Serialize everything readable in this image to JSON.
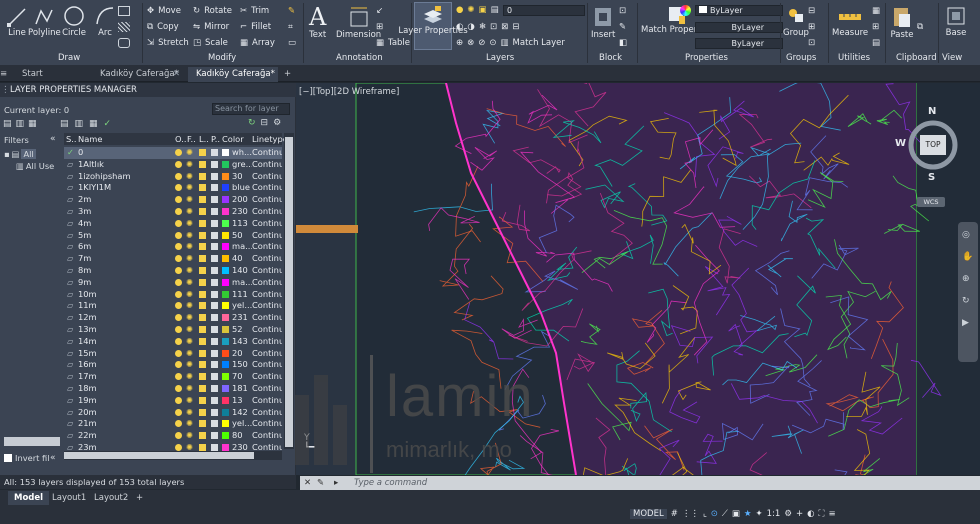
{
  "ribbon": {
    "draw": {
      "line": "Line",
      "polyline": "Polyline",
      "circle": "Circle",
      "arc": "Arc",
      "panel": "Draw"
    },
    "modify": {
      "move": "Move",
      "rotate": "Rotate",
      "trim": "Trim",
      "copy": "Copy",
      "mirror": "Mirror",
      "fillet": "Fillet",
      "stretch": "Stretch",
      "scale": "Scale",
      "array": "Array",
      "panel": "Modify"
    },
    "annotation": {
      "text": "Text",
      "dimension": "Dimension",
      "table": "Table",
      "panel": "Annotation"
    },
    "layers": {
      "layer_properties": "Layer Properties",
      "current_layer_value": "0",
      "match_layer": "Match Layer",
      "panel": "Layers"
    },
    "block": {
      "insert": "Insert",
      "panel": "Block"
    },
    "properties": {
      "match_properties": "Match Properties",
      "bylayer_color": "ByLayer",
      "bylayer_linetype": "ByLayer",
      "bylayer_lineweight": "ByLayer",
      "panel": "Properties"
    },
    "groups": {
      "group": "Group",
      "panel": "Groups"
    },
    "utilities": {
      "measure": "Measure",
      "panel": "Utilities"
    },
    "clipboard": {
      "paste": "Paste",
      "panel": "Clipboard"
    },
    "view": {
      "base": "Base",
      "panel": "View"
    }
  },
  "doc_tabs": {
    "start": "Start",
    "tab1": "Kadıköy Caferağa*",
    "tab2": "Kadıköy Caferağa*"
  },
  "layer_manager": {
    "title": "LAYER PROPERTIES MANAGER",
    "current_layer": "Current layer: 0",
    "search_placeholder": "Search for layer",
    "filters_label": "Filters",
    "tree_all": "All",
    "tree_used": "All Use",
    "invert_filter": "Invert fil",
    "columns": {
      "status": "S..",
      "name": "Name",
      "on": "O..",
      "freeze": "F..",
      "lock": "L..",
      "plot": "P..",
      "color": "Color",
      "linetype": "Linetype"
    },
    "layers": [
      {
        "name": "0",
        "color": "wh...",
        "hex": "#ffffff",
        "linetype": "Continu..."
      },
      {
        "name": "1Altlık",
        "color": "gre...",
        "hex": "#22c55e",
        "linetype": "Continu..."
      },
      {
        "name": "1izohipsham",
        "color": "30",
        "hex": "#ff8c1a",
        "linetype": "Continu..."
      },
      {
        "name": "1KIYI1M",
        "color": "blue",
        "hex": "#2040ff",
        "linetype": "Continu..."
      },
      {
        "name": "2m",
        "color": "200",
        "hex": "#9933ff",
        "linetype": "Continu..."
      },
      {
        "name": "3m",
        "color": "230",
        "hex": "#ff33cc",
        "linetype": "Continu..."
      },
      {
        "name": "4m",
        "color": "113",
        "hex": "#4dff4d",
        "linetype": "Continu..."
      },
      {
        "name": "5m",
        "color": "50",
        "hex": "#ffe600",
        "linetype": "Continu..."
      },
      {
        "name": "6m",
        "color": "ma...",
        "hex": "#ff00ff",
        "linetype": "Continu..."
      },
      {
        "name": "7m",
        "color": "40",
        "hex": "#ffbf00",
        "linetype": "Continu..."
      },
      {
        "name": "8m",
        "color": "140",
        "hex": "#00bfff",
        "linetype": "Continu..."
      },
      {
        "name": "9m",
        "color": "ma...",
        "hex": "#ff00ff",
        "linetype": "Continu..."
      },
      {
        "name": "10m",
        "color": "111",
        "hex": "#33cc33",
        "linetype": "Continu..."
      },
      {
        "name": "11m",
        "color": "yel...",
        "hex": "#ffff00",
        "linetype": "Continu..."
      },
      {
        "name": "12m",
        "color": "231",
        "hex": "#ff6699",
        "linetype": "Continu..."
      },
      {
        "name": "13m",
        "color": "52",
        "hex": "#d9c43a",
        "linetype": "Continu..."
      },
      {
        "name": "14m",
        "color": "143",
        "hex": "#1a9fbf",
        "linetype": "Continu..."
      },
      {
        "name": "15m",
        "color": "20",
        "hex": "#ff4d1a",
        "linetype": "Continu..."
      },
      {
        "name": "16m",
        "color": "150",
        "hex": "#0080ff",
        "linetype": "Continu..."
      },
      {
        "name": "17m",
        "color": "70",
        "hex": "#80ff00",
        "linetype": "Continu..."
      },
      {
        "name": "18m",
        "color": "181",
        "hex": "#7f66ff",
        "linetype": "Continu..."
      },
      {
        "name": "19m",
        "color": "13",
        "hex": "#ff3366",
        "linetype": "Continu..."
      },
      {
        "name": "20m",
        "color": "142",
        "hex": "#0f7f99",
        "linetype": "Continu..."
      },
      {
        "name": "21m",
        "color": "yel...",
        "hex": "#ffff00",
        "linetype": "Continu..."
      },
      {
        "name": "22m",
        "color": "80",
        "hex": "#4dff00",
        "linetype": "Continu..."
      },
      {
        "name": "23m",
        "color": "230",
        "hex": "#ff33cc",
        "linetype": "Continu..."
      }
    ],
    "status": "All: 153 layers displayed of 153 total layers"
  },
  "viewport": {
    "label": "[−][Top][2D Wireframe]",
    "compass_n": "N",
    "compass_s": "S",
    "compass_w": "W",
    "cube_top": "TOP",
    "wcs": "WCS"
  },
  "watermark": {
    "big": "lamin",
    "small": "mimarlık, mo"
  },
  "command": {
    "placeholder": "Type a command"
  },
  "bottom_tabs": {
    "model": "Model",
    "layout1": "Layout1",
    "layout2": "Layout2"
  },
  "statusbar": {
    "model": "MODEL",
    "scale": "1:1"
  }
}
